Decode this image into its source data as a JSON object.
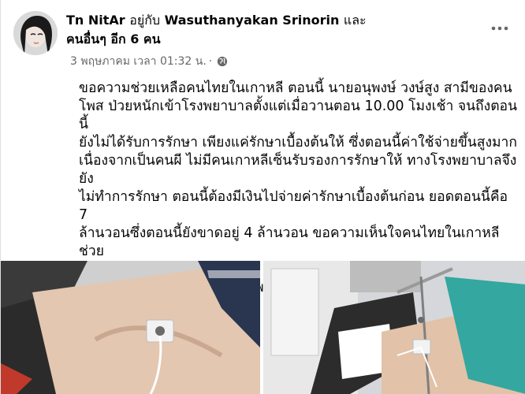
{
  "post": {
    "author": "Tn NitAr",
    "with_word": "อยู่กับ",
    "tagged": "Wasuthanyakan Srinorin",
    "and_word": "และ",
    "others": "คนอื่นๆ อีก 6 คน",
    "date": "3 พฤษภาคม เวลา 01:32 น.",
    "dot": "·",
    "privacy_icon": "globe-icon",
    "more_icon": "more-options-icon",
    "text": "ขอความช่วยเหลือคนไทยในเกาหลี ตอนนี้ นายอนุพงษ์ วงษ์สูง สามีของคน\nโพส ป่วยหนักเข้าโรงพยาบาลตั้งแต่เมื่อวานตอน 10.00 โมงเช้า จนถึงตอนนี้\nยังไม่ได้รับการรักษา เพียงแค่รักษาเบื้องต้นให้ ซึ่งตอนนี้ค่าใช้จ่ายขึ้นสูงมาก\nเนื่องจากเป็นคนผี ไม่มีคนเกาหลีเซ็นรับรองการรักษาให้ ทางโรงพยาบาลจึงยัง\nไม่ทำการรักษา ตอนนี้ต้องมีเงินไปจ่ายค่ารักษาเบื้องต้นก่อน ยอดตอนนี้คือ 7\nล้านวอนซึ่งตอนนี้ยังขาดอยู่ 4 ล้านวอน ขอความเห็นใจคนไทยในเกาหลี ช่วย\nสามีหนูด้วยคะ 😭😭\nบช.ธนาคารเป็นบัญชีของคนโพสซึ่งเป็นภรรยาคะ"
  },
  "colors": {
    "text": "#050505",
    "secondary": "#65676b",
    "background": "#ffffff"
  }
}
